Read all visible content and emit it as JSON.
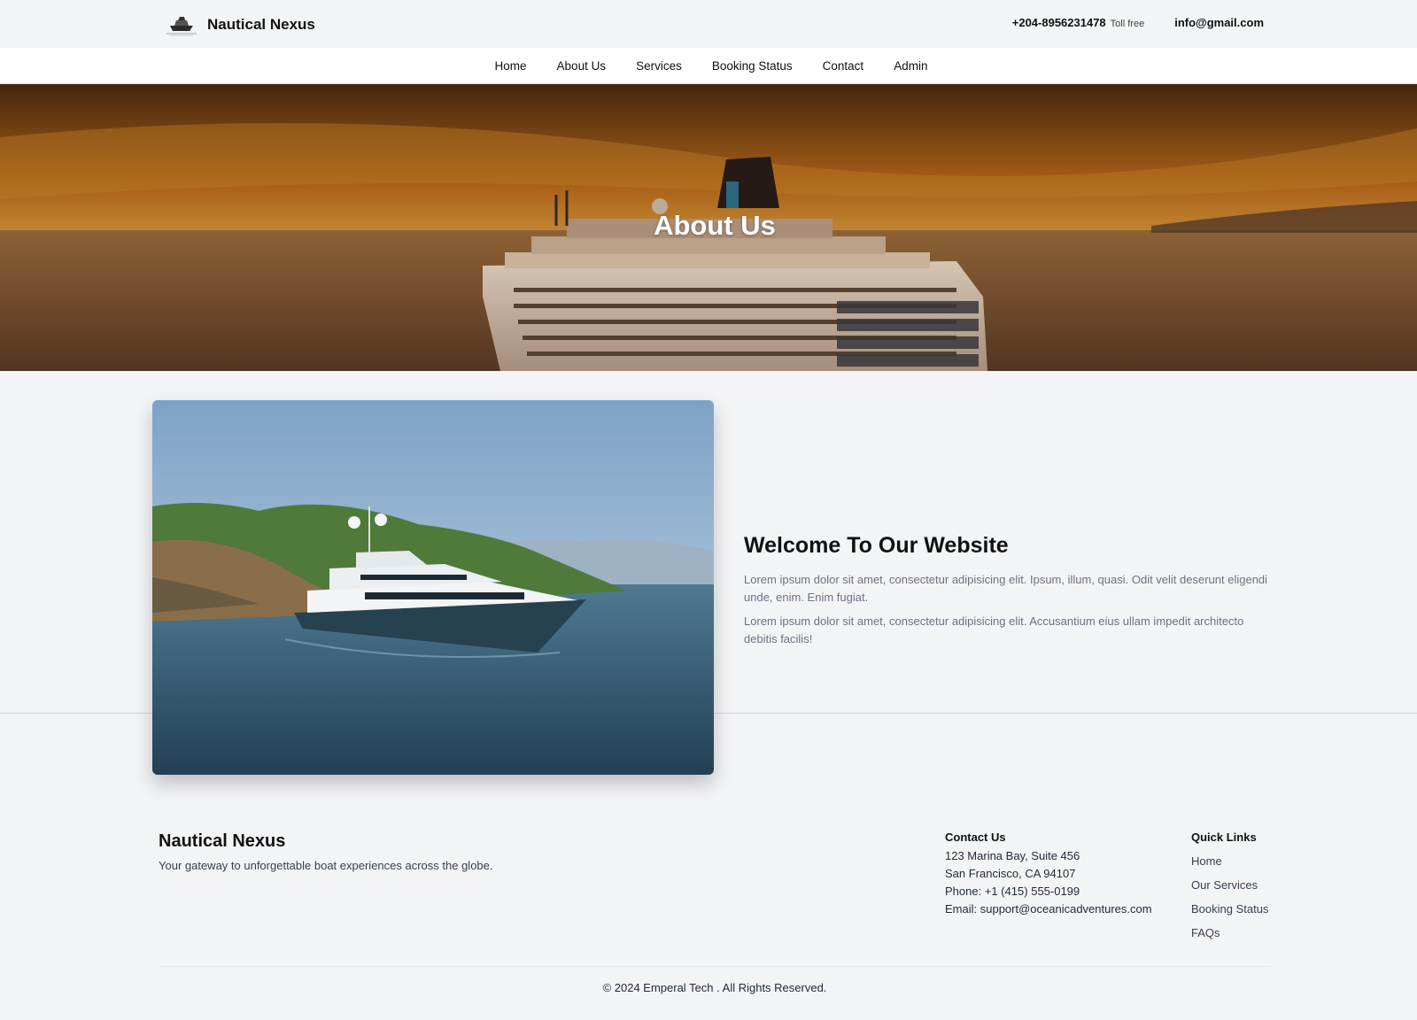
{
  "brand": {
    "name": "Nautical Nexus",
    "logo_icon": "ship-logo-icon"
  },
  "top_contact": {
    "phone": "+204-8956231478",
    "phone_note": "Toll free",
    "email": "info@gmail.com"
  },
  "nav": {
    "items": [
      {
        "label": "Home"
      },
      {
        "label": "About Us"
      },
      {
        "label": "Services"
      },
      {
        "label": "Booking Status"
      },
      {
        "label": "Contact"
      },
      {
        "label": "Admin"
      }
    ]
  },
  "hero": {
    "title": "About Us"
  },
  "about": {
    "heading": "Welcome To Our Website",
    "paragraphs": [
      "Lorem ipsum dolor sit amet, consectetur adipisicing elit. Ipsum, illum, quasi. Odit velit deserunt eligendi unde, enim. Enim fugiat.",
      "Lorem ipsum dolor sit amet, consectetur adipisicing elit. Accusantium eius ullam impedit architecto debitis facilis!"
    ]
  },
  "footer": {
    "brand_name": "Nautical Nexus",
    "tagline": "Your gateway to unforgettable boat experiences across the globe.",
    "contact": {
      "title": "Contact Us",
      "lines": [
        "123 Marina Bay, Suite 456",
        "San Francisco, CA 94107",
        "Phone: +1 (415) 555-0199",
        "Email: support@oceanicadventures.com"
      ]
    },
    "quick_links": {
      "title": "Quick Links",
      "items": [
        "Home",
        "Our Services",
        "Booking Status",
        "FAQs"
      ]
    },
    "copyright": "© 2024 Emperal Tech . All Rights Reserved."
  },
  "colors": {
    "page_bg": "#f3f4f6",
    "nav_bg": "#ffffff",
    "hero_sky": "#c77a1c",
    "text_muted": "#6b7280"
  }
}
